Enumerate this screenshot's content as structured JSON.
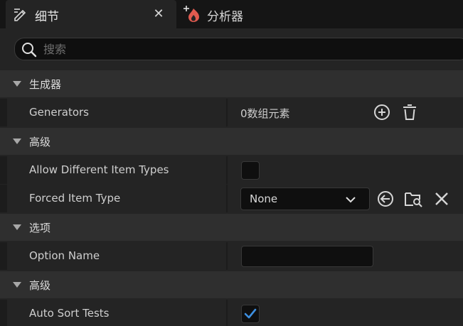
{
  "tabs": {
    "details_label": "细节",
    "close_label": "✕",
    "profiler_label": "分析器"
  },
  "search": {
    "placeholder": "搜索",
    "value": ""
  },
  "sections": {
    "generator": {
      "label": "生成器"
    },
    "advanced1": {
      "label": "高级"
    },
    "options": {
      "label": "选项"
    },
    "advanced2": {
      "label": "高级"
    }
  },
  "properties": {
    "generators": {
      "label": "Generators",
      "value": "0数组元素"
    },
    "allow_different_item_types": {
      "label": "Allow Different Item Types",
      "checked": false
    },
    "forced_item_type": {
      "label": "Forced Item Type",
      "value": "None"
    },
    "option_name": {
      "label": "Option Name",
      "value": ""
    },
    "auto_sort_tests": {
      "label": "Auto Sort Tests",
      "checked": true
    }
  },
  "colors": {
    "accent": "#3d8fe0",
    "profiler_icon": "#e05a4f",
    "background": "#242424"
  }
}
